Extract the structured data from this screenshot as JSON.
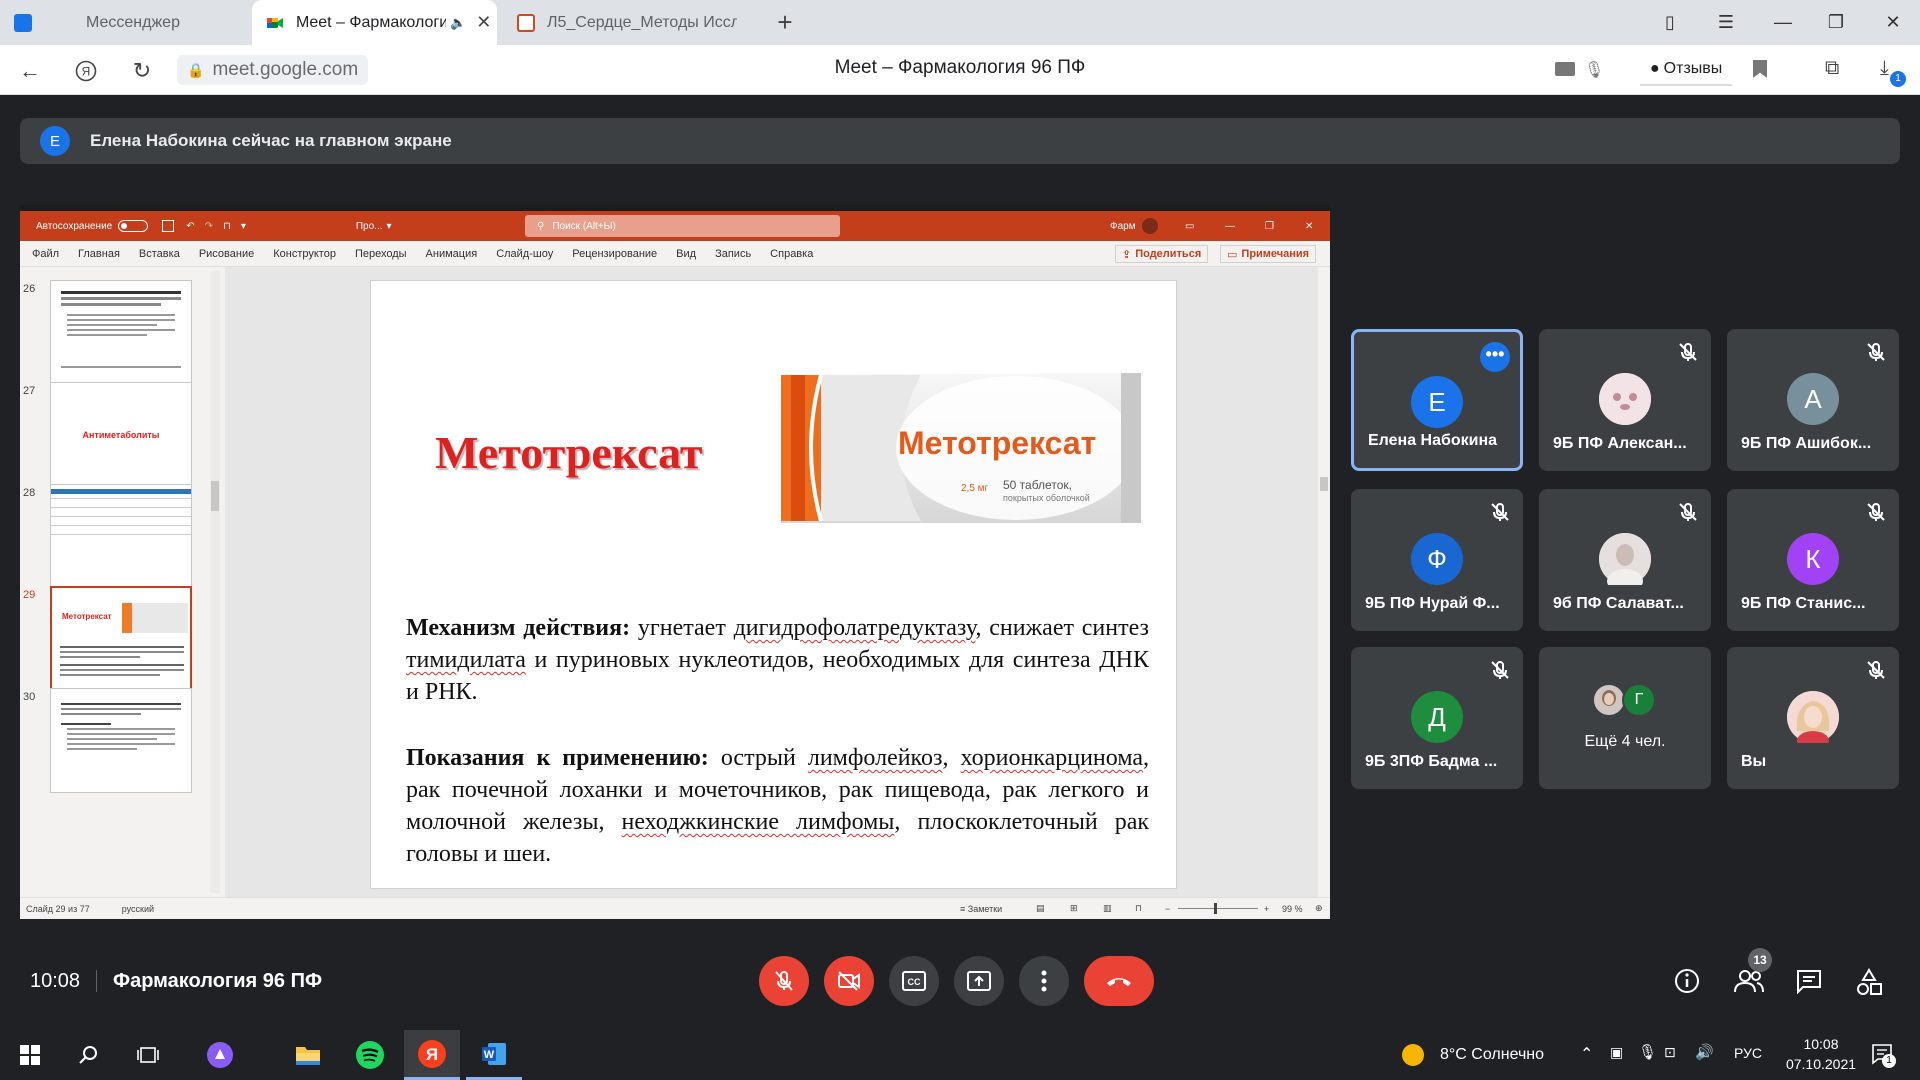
{
  "browser": {
    "tabs": [
      {
        "title": "Мессенджер",
        "active": false
      },
      {
        "title": "Meet – Фармакологи",
        "active": true
      },
      {
        "title": "Л5_Сердце_Методы Иссл",
        "active": false
      }
    ],
    "url": "meet.google.com",
    "page_title": "Meet – Фармакология 96 ПФ",
    "feedback_label": "Отзывы",
    "downloads_badge": "1"
  },
  "meet": {
    "banner": {
      "avatar_letter": "Е",
      "text": "Елена Набокина сейчас на главном экране"
    },
    "participants": [
      {
        "name": "Елена Набокина",
        "letter": "Е",
        "color": "#1a73e8",
        "active": true,
        "muted": false
      },
      {
        "name": "9Б ПФ Алексан...",
        "letter": "",
        "color": "#e8d0d6",
        "active": false,
        "muted": true
      },
      {
        "name": "9Б ПФ Ашибок...",
        "letter": "А",
        "color": "#78909c",
        "active": false,
        "muted": true
      },
      {
        "name": "9Б ПФ Нурай Ф...",
        "letter": "Ф",
        "color": "#1967d2",
        "active": false,
        "muted": true
      },
      {
        "name": "9б ПФ Салават...",
        "letter": "",
        "color": "#d9d0cc",
        "active": false,
        "muted": true
      },
      {
        "name": "9Б ПФ Станис...",
        "letter": "К",
        "color": "#a142f4",
        "active": false,
        "muted": true
      },
      {
        "name": "9Б 3ПФ Бадма ...",
        "letter": "Д",
        "color": "#1e8e3e",
        "active": false,
        "muted": true
      },
      {
        "name": "Ещё 4 чел.",
        "letter": "Г",
        "color": "#188038",
        "active": false,
        "muted": false
      },
      {
        "name": "Вы",
        "letter": "",
        "color": "#e6b0b4",
        "active": false,
        "muted": true
      }
    ],
    "time": "10:08",
    "meeting_title": "Фармакология 96 ПФ",
    "people_count": "13"
  },
  "ppt": {
    "autosave": "Автосохранение",
    "file_short": "Про...",
    "search_placeholder": "Поиск (Alt+Ы)",
    "user_short": "Фарм",
    "menu": [
      "Файл",
      "Главная",
      "Вставка",
      "Рисование",
      "Конструктор",
      "Переходы",
      "Анимация",
      "Слайд-шоу",
      "Рецензирование",
      "Вид",
      "Запись",
      "Справка"
    ],
    "share": "Поделиться",
    "notes_btn": "Примечания",
    "thumbs": [
      {
        "num": "26",
        "title": ""
      },
      {
        "num": "27",
        "title": "Антиметаболиты"
      },
      {
        "num": "28",
        "title": ""
      },
      {
        "num": "29",
        "title": "Метотрексат"
      },
      {
        "num": "30",
        "title": ""
      }
    ],
    "status_slide": "Слайд 29 из 77",
    "status_lang": "русский",
    "status_notes": "Заметки",
    "zoom": "99 %"
  },
  "slide": {
    "title": "Метотрексат",
    "box": {
      "brand": "Метотрексат",
      "dose": "2,5 мг",
      "pack": "50 таблеток,",
      "pack2": "покрытых оболочкой"
    },
    "mech_label": "Механизм действия:",
    "mech_1": "угнетает",
    "mech_2": "дигидрофолатредуктазу",
    "mech_3": ", снижает синтез",
    "mech_4": "тимидилата",
    "mech_5": "и пуриновых нуклеотидов, необходимых для синтеза ДНК и РНК.",
    "ind_label": "Показания к применению:",
    "ind_1": "острый",
    "ind_2": "лимфолейкоз",
    "ind_3": ",",
    "ind_4": "хорионкарцинома",
    "ind_5": ", рак почечной лоханки и мочеточников, рак пищевода, рак легкого и молочной железы,",
    "ind_6": "неходжкинские лимфомы",
    "ind_7": ", плоскоклеточный рак головы и шеи."
  },
  "taskbar": {
    "weather": "8°C Солнечно",
    "lang": "РУС",
    "time": "10:08",
    "date": "07.10.2021"
  }
}
